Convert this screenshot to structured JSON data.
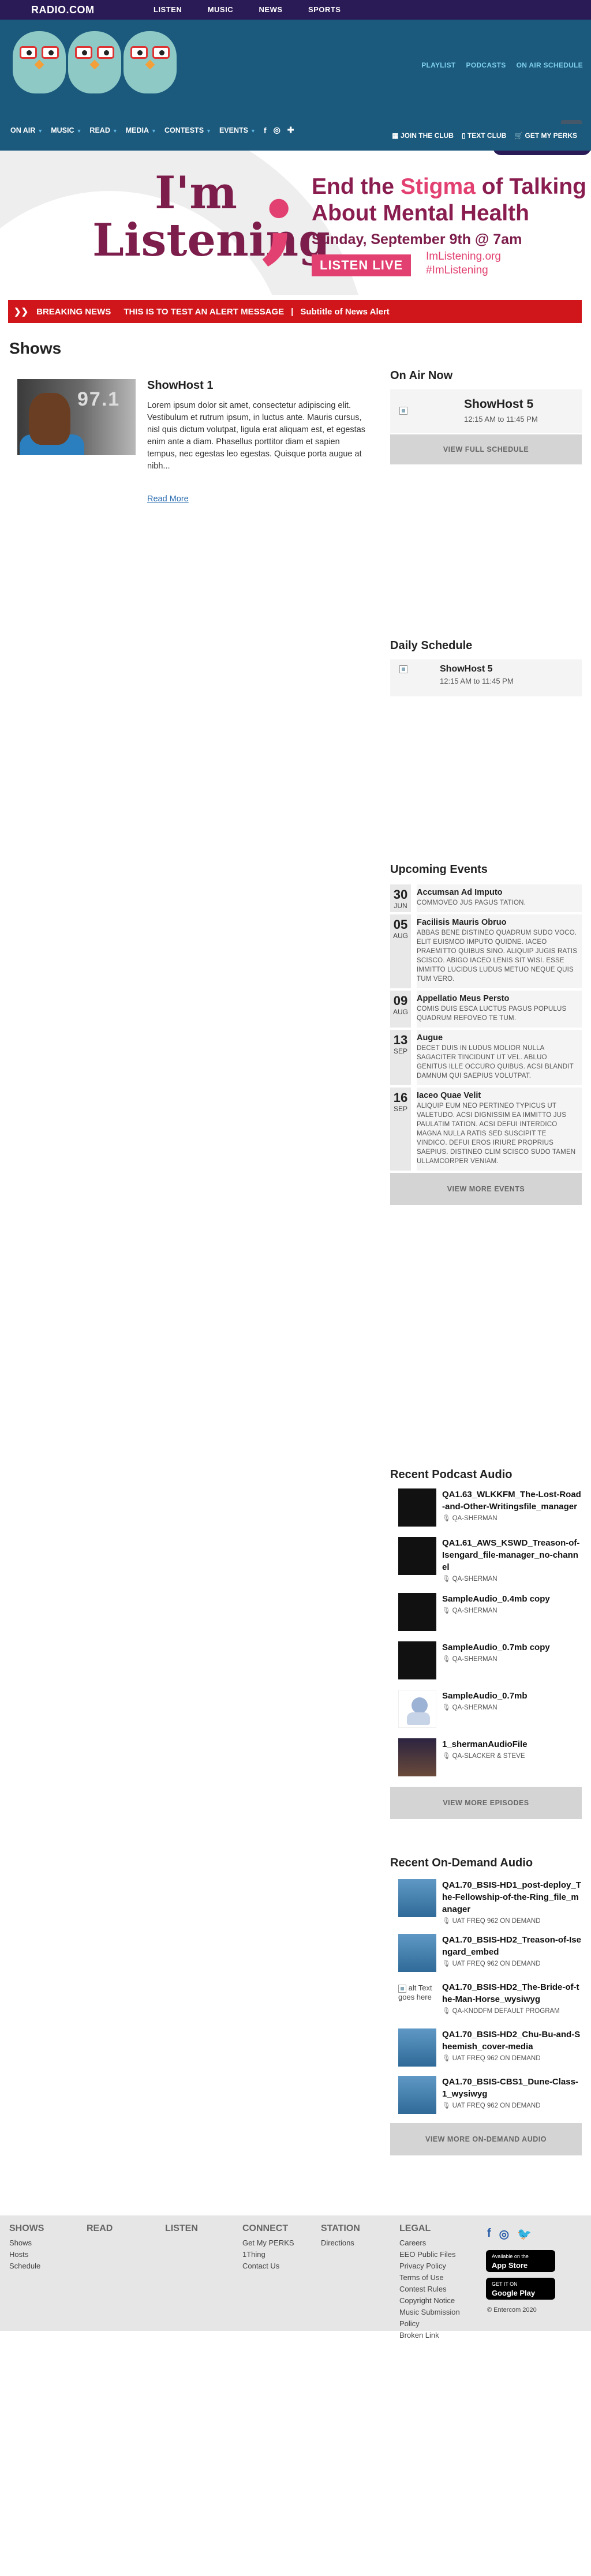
{
  "topbar": {
    "logo": "RADIO.COM",
    "nav": [
      "LISTEN",
      "MUSIC",
      "NEWS",
      "SPORTS"
    ]
  },
  "station": {
    "links": [
      "PLAYLIST",
      "PODCASTS",
      "ON AIR SCHEDULE"
    ],
    "nav": [
      "ON AIR",
      "MUSIC",
      "READ",
      "MEDIA",
      "CONTESTS",
      "EVENTS"
    ],
    "perks": [
      "JOIN THE CLUB",
      "TEXT CLUB",
      "GET MY PERKS"
    ]
  },
  "banner": {
    "im": "I'm",
    "listening": "Listening",
    "headline_a": "End the ",
    "headline_b": "Stigma",
    "headline_c": " of Talking About Mental Health",
    "date": "Sunday, September 9th @ 7am",
    "button": "LISTEN LIVE",
    "site": "ImListening.org",
    "hashtag": "#ImListening"
  },
  "breaking": {
    "label": "BREAKING NEWS",
    "message": "THIS IS TO TEST AN ALERT MESSAGE",
    "subtitle": "Subtitle of News Alert"
  },
  "shows": {
    "title": "Shows",
    "card": {
      "name": "ShowHost 1",
      "desc": "Lorem ipsum dolor sit amet, consectetur adipiscing elit. Vestibulum et rutrum ipsum, in luctus ante. Mauris cursus, nisl quis dictum volutpat, ligula erat aliquam est, et egestas enim ante a diam. Phasellus porttitor diam et sapien tempus, nec egestas leo egestas. Quisque porta augue at nibh...",
      "more": "Read More",
      "img_text": "97.1"
    }
  },
  "onair": {
    "title": "On Air Now",
    "host": "ShowHost 5",
    "time": "12:15 AM to 11:45 PM",
    "button": "VIEW FULL SCHEDULE"
  },
  "daily": {
    "title": "Daily Schedule",
    "host": "ShowHost 5",
    "time": "12:15 AM to 11:45 PM"
  },
  "events": {
    "title": "Upcoming Events",
    "items": [
      {
        "day": "30",
        "mon": "JUN",
        "title": "Accumsan Ad Imputo",
        "desc": "COMMOVEO JUS PAGUS TATION."
      },
      {
        "day": "05",
        "mon": "AUG",
        "title": "Facilisis Mauris Obruo",
        "desc": "ABBAS BENE DISTINEO QUADRUM SUDO VOCO. ELIT EUISMOD IMPUTO QUIDNE. IACEO PRAEMITTO QUIBUS SINO. ALIQUIP JUGIS RATIS SCISCO. ABIGO IACEO LENIS SIT WISI. ESSE IMMITTO LUCIDUS LUDUS METUO NEQUE QUIS TUM VERO."
      },
      {
        "day": "09",
        "mon": "AUG",
        "title": "Appellatio Meus Persto",
        "desc": "COMIS DUIS ESCA LUCTUS PAGUS POPULUS QUADRUM REFOVEO TE TUM."
      },
      {
        "day": "13",
        "mon": "SEP",
        "title": "Augue",
        "desc": "DECET DUIS IN LUDUS MOLIOR NULLA SAGACITER TINCIDUNT UT VEL. ABLUO GENITUS ILLE OCCURO QUIBUS. ACSI BLANDIT DAMNUM QUI SAEPIUS VOLUTPAT."
      },
      {
        "day": "16",
        "mon": "SEP",
        "title": "Iaceo Quae Velit",
        "desc": "ALIQUIP EUM NEO PERTINEO TYPICUS UT VALETUDO. ACSI DIGNISSIM EA IMMITTO JUS PAULATIM TATION. ACSI DEFUI INTERDICO MAGNA NULLA RATIS SED SUSCIPIT TE VINDICO. DEFUI EROS IRIURE PROPRIUS SAEPIUS. DISTINEO CLIM SCISCO SUDO TAMEN ULLAMCORPER VENIAM."
      }
    ],
    "button": "VIEW MORE EVENTS"
  },
  "podcasts": {
    "title": "Recent Podcast Audio",
    "items": [
      {
        "title": "QA1.63_WLKKFM_The-Lost-Road-and-Other-Writingsfile_manager",
        "sub": "QA-SHERMAN",
        "thumb": "galaxy"
      },
      {
        "title": "QA1.61_AWS_KSWD_Treason-of-Isengard_file-manager_no-channel",
        "sub": "QA-SHERMAN",
        "thumb": "galaxy"
      },
      {
        "title": "SampleAudio_0.4mb copy",
        "sub": "QA-SHERMAN",
        "thumb": "galaxy"
      },
      {
        "title": "SampleAudio_0.7mb copy",
        "sub": "QA-SHERMAN",
        "thumb": "galaxy"
      },
      {
        "title": "SampleAudio_0.7mb",
        "sub": "QA-SHERMAN",
        "thumb": "cartoon"
      },
      {
        "title": "1_shermanAudioFile",
        "sub": "QA-SLACKER & STEVE",
        "thumb": "concert"
      }
    ],
    "button": "VIEW MORE EPISODES"
  },
  "ondemand": {
    "title": "Recent On-Demand Audio",
    "items": [
      {
        "title": "QA1.70_BSIS-HD1_post-deploy_The-Fellowship-of-the-Ring_file_manager",
        "sub": "UAT FREQ 962 ON DEMAND"
      },
      {
        "title": "QA1.70_BSIS-HD2_Treason-of-Isengard_embed",
        "sub": "UAT FREQ 962 ON DEMAND"
      },
      {
        "title": "QA1.70_BSIS-HD2_The-Bride-of-the-Man-Horse_wysiwyg",
        "sub": "QA-KNDDFM DEFAULT PROGRAM",
        "alt": "alt Text goes here"
      },
      {
        "title": "QA1.70_BSIS-HD2_Chu-Bu-and-Sheemish_cover-media",
        "sub": "UAT FREQ 962 ON DEMAND"
      },
      {
        "title": "QA1.70_BSIS-CBS1_Dune-Class-1_wysiwyg",
        "sub": "UAT FREQ 962 ON DEMAND"
      }
    ],
    "button": "VIEW MORE ON-DEMAND AUDIO"
  },
  "footer": {
    "cols": [
      {
        "head": "SHOWS",
        "links": [
          "Shows",
          "Hosts",
          "Schedule"
        ]
      },
      {
        "head": "READ",
        "links": []
      },
      {
        "head": "LISTEN",
        "links": []
      },
      {
        "head": "CONNECT",
        "links": [
          "Get My PERKS",
          "1Thing",
          "Contact Us"
        ]
      },
      {
        "head": "STATION",
        "links": [
          "Directions"
        ]
      },
      {
        "head": "LEGAL",
        "links": [
          "Careers",
          "EEO Public Files",
          "Privacy Policy",
          "Terms of Use",
          "Contest Rules",
          "Copyright Notice",
          "Music Submission Policy",
          "Broken Link"
        ]
      }
    ],
    "appstore_small": "Available on the",
    "appstore": "App Store",
    "gplay_small": "GET IT ON",
    "gplay": "Google Play",
    "copyright": "© Entercom 2020"
  }
}
